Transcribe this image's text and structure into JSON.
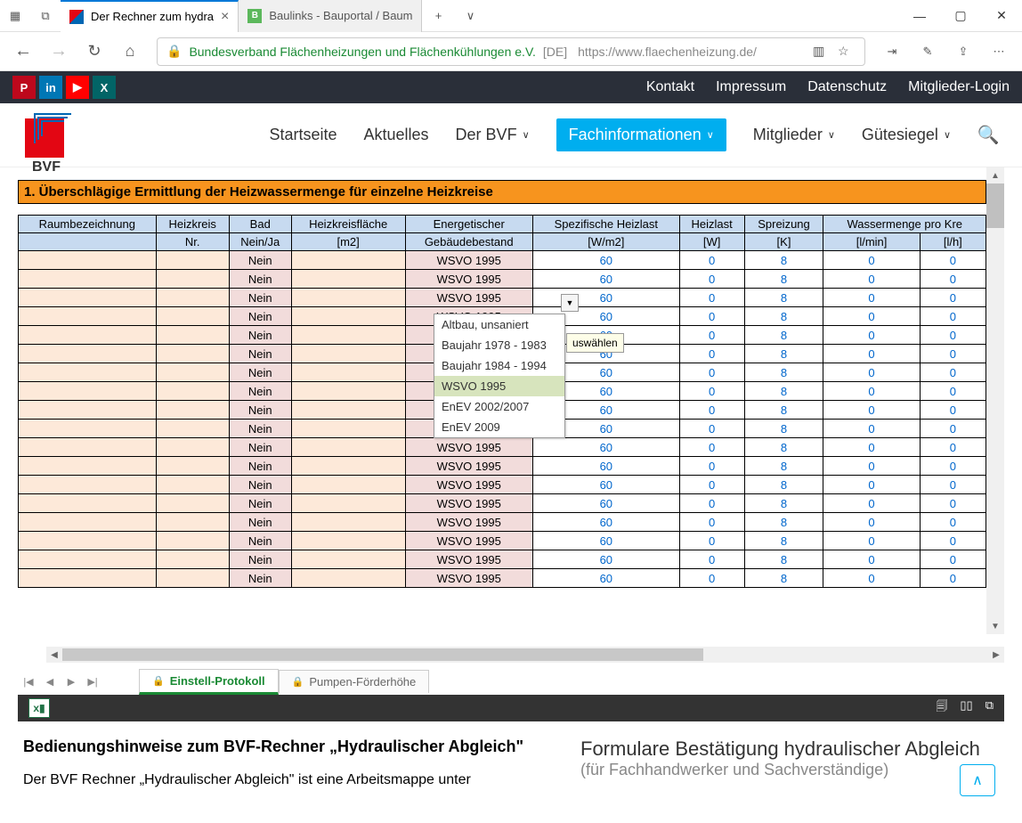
{
  "browser": {
    "tabs": [
      {
        "title": "Der Rechner zum hydra",
        "active": true
      },
      {
        "title": "Baulinks - Bauportal / Baum",
        "active": false
      }
    ],
    "back": "←",
    "forward": "→",
    "refresh": "↻",
    "home": "⌂",
    "siteName": "Bundesverband Flächenheizungen und Flächenkühlungen e.V.",
    "cert": "[DE]",
    "url": "https://www.flaechenheizung.de/",
    "min": "—",
    "max": "▢",
    "close": "✕",
    "more": "⋯"
  },
  "topLinks": [
    "Kontakt",
    "Impressum",
    "Datenschutz",
    "Mitglieder-Login"
  ],
  "nav": {
    "logo": "BVF",
    "items": [
      {
        "label": "Startseite",
        "chev": false,
        "active": false
      },
      {
        "label": "Aktuelles",
        "chev": false,
        "active": false
      },
      {
        "label": "Der BVF",
        "chev": true,
        "active": false
      },
      {
        "label": "Fachinformationen",
        "chev": true,
        "active": true
      },
      {
        "label": "Mitglieder",
        "chev": true,
        "active": false
      },
      {
        "label": "Gütesiegel",
        "chev": true,
        "active": false
      }
    ]
  },
  "sheet": {
    "title": "1. Überschlägige Ermittlung der Heizwassermenge für einzelne Heizkreise",
    "headers1": [
      "Raumbezeichnung",
      "Heizkreis",
      "Bad",
      "Heizkreisfläche",
      "Energetischer",
      "Spezifische Heizlast",
      "Heizlast",
      "Spreizung",
      "Wassermenge pro Kre"
    ],
    "headers2": [
      "",
      "Nr.",
      "Nein/Ja",
      "[m2]",
      "Gebäudebestand",
      "[W/m2]",
      "[W]",
      "[K]",
      "[l/min]",
      "[l/h]"
    ],
    "row": {
      "bad": "Nein",
      "geb": "WSVO 1995",
      "heiz": "60",
      "last": "0",
      "spr": "8",
      "lmin": "0",
      "lh": "0"
    },
    "rowCount": 18,
    "dropdown": {
      "options": [
        "Altbau, unsaniert",
        "Baujahr 1978 - 1983",
        "Baujahr 1984 - 1994",
        "WSVO 1995",
        "EnEV 2002/2007",
        "EnEV 2009"
      ],
      "selected": "WSVO 1995",
      "tooltip": "uswählen"
    },
    "tabs": [
      {
        "label": "Einstell-Protokoll",
        "active": true
      },
      {
        "label": "Pumpen-Förderhöhe",
        "active": false
      }
    ]
  },
  "content": {
    "leftH": "Bedienungshinweise zum BVF-Rechner „Hydraulischer Abgleich\"",
    "leftP": "Der BVF Rechner „Hydraulischer Abgleich\" ist eine Arbeitsmappe unter",
    "rightH": "Formulare Bestätigung hydraulischer Abgleich",
    "rightSub": "(für Fachhandwerker und Sachverständige)"
  }
}
